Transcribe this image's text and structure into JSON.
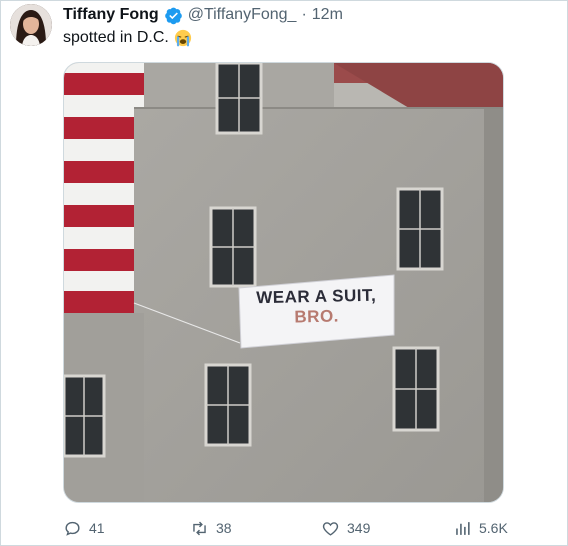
{
  "author": {
    "display_name": "Tiffany Fong",
    "handle": "@TiffanyFong_",
    "separator": "·",
    "time": "12m",
    "avatar_icon": "avatar",
    "verified_icon": "verified-badge-icon"
  },
  "tweet": {
    "text": "spotted in D.C.",
    "emoji_icon": "loudly-crying-face-emoji"
  },
  "photo": {
    "banner_line1": "WEAR A SUIT,",
    "banner_line2": "BRO."
  },
  "actions": {
    "reply_count": "41",
    "retweet_count": "38",
    "like_count": "349",
    "view_count": "5.6K"
  },
  "colors": {
    "link_gray": "#536471",
    "verified_blue": "#1d9bf0",
    "stripe_red": "#b22234"
  }
}
